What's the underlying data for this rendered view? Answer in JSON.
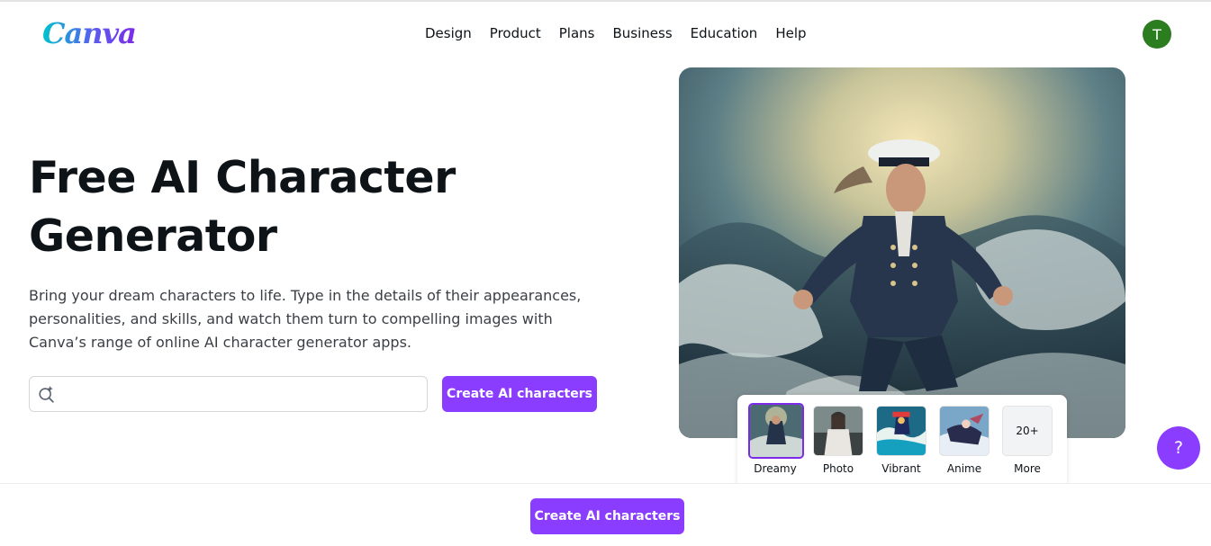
{
  "header": {
    "logo": "Canva",
    "nav": [
      "Design",
      "Product",
      "Plans",
      "Business",
      "Education",
      "Help"
    ],
    "avatar_initial": "T"
  },
  "hero": {
    "title_line1": "Free AI Character",
    "title_line2": "Generator",
    "description": "Bring your dream characters to life. Type in the details of their appearances, personalities, and skills, and watch them turn to compelling images with Canva’s range of online AI character generator apps.",
    "search_value": "",
    "cta_label": "Create AI characters",
    "image_icon": "ai-sea-captain-illustration"
  },
  "styles": {
    "selected": "Dreamy",
    "options": [
      {
        "label": "Dreamy"
      },
      {
        "label": "Photo"
      },
      {
        "label": "Vibrant"
      },
      {
        "label": "Anime"
      },
      {
        "label": "More",
        "badge": "20+"
      }
    ]
  },
  "help": {
    "label": "?"
  },
  "sticky": {
    "cta_label": "Create AI characters"
  },
  "colors": {
    "accent": "#8b3dff",
    "avatar": "#2c7d1f",
    "selected_border": "#7d2ae8"
  }
}
